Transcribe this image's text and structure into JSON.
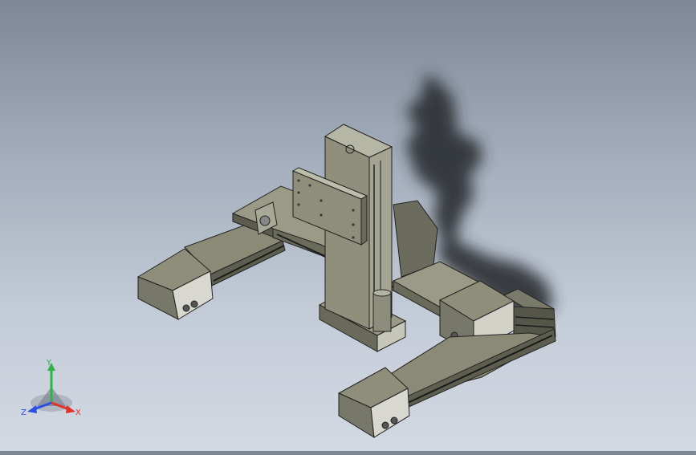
{
  "viewport": {
    "model": "gantry-robot-assembly",
    "background_top": "#7e8796",
    "background_bottom": "#d3d9e2"
  },
  "triad": {
    "x_label": "X",
    "y_label": "Y",
    "z_label": "Z",
    "x_color": "#e0322a",
    "y_color": "#2fb24a",
    "z_color": "#2d4fe0"
  }
}
